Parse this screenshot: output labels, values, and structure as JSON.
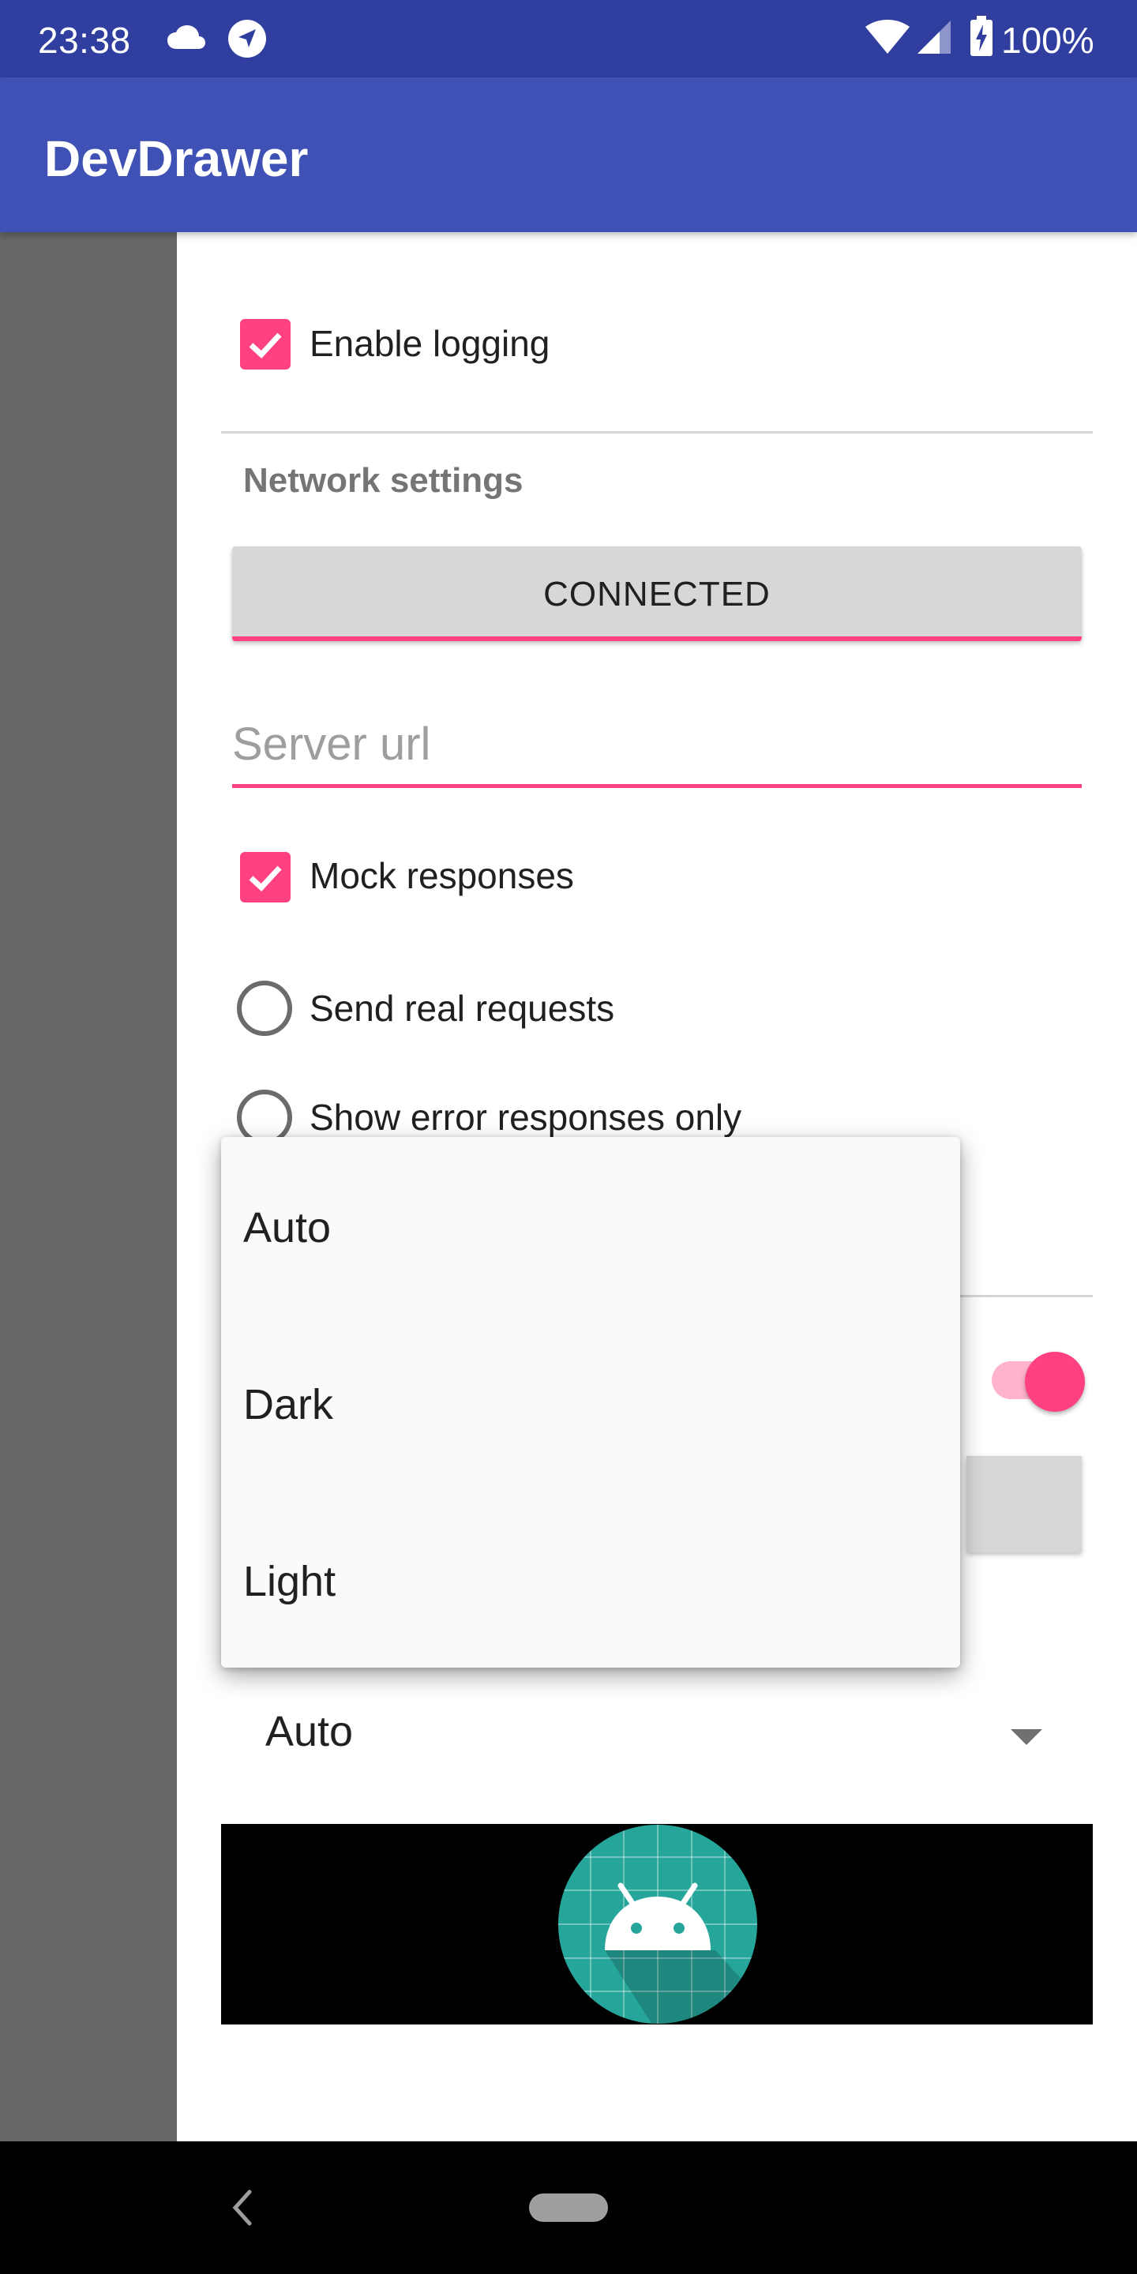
{
  "status_bar": {
    "time": "23:38",
    "battery": "100%",
    "icons": [
      "cloud-icon",
      "navigation-icon",
      "wifi-icon",
      "signal-icon",
      "battery-charging-icon"
    ]
  },
  "app_bar": {
    "title": "DevDrawer",
    "color": "#3f51b5",
    "status_color": "#303f9f"
  },
  "drawer": {
    "enable_logging": {
      "label": "Enable logging",
      "checked": true
    },
    "network_section_title": "Network settings",
    "connected_button_label": "CONNECTED",
    "server_url": {
      "value": "",
      "placeholder": "Server url"
    },
    "mock_responses": {
      "label": "Mock responses",
      "checked": true
    },
    "radio_options": [
      {
        "label": "Send real requests",
        "selected": false
      },
      {
        "label": "Show error responses only",
        "selected": false
      }
    ],
    "toggle_switch": {
      "on": true
    },
    "theme_spinner": {
      "selected": "Auto"
    }
  },
  "dropdown": {
    "options": [
      "Auto",
      "Dark",
      "Light"
    ]
  },
  "colors": {
    "accent": "#ff4081",
    "primary": "#3f51b5",
    "primary_dark": "#303f9f"
  }
}
